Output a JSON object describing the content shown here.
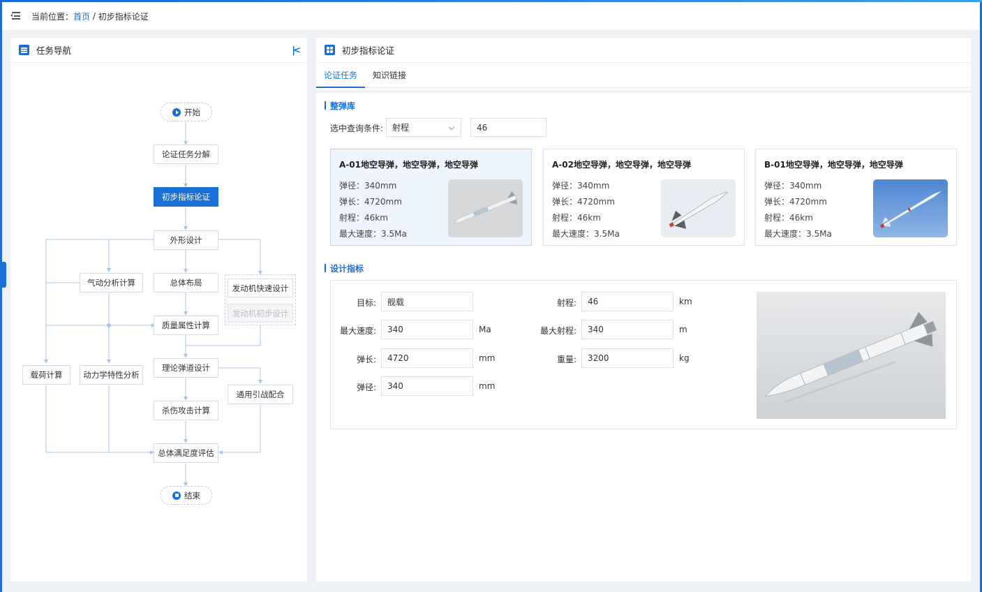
{
  "breadcrumb": {
    "prefix": "当前位置：",
    "home": "首页",
    "separator": " / ",
    "current": "初步指标论证"
  },
  "left_panel": {
    "title": "任务导航",
    "nodes": {
      "start": "开始",
      "task_decompose": "论证任务分解",
      "preliminary_index": "初步指标论证",
      "shape_design": "外形设计",
      "aero_calc": "气动分析计算",
      "overall_layout": "总体布局",
      "engine_fast": "发动机快速设计",
      "engine_prelim": "发动机初步设计",
      "mass_calc": "质量属性计算",
      "trajectory": "理论弹道设计",
      "payload_calc": "载荷计算",
      "dynamics": "动力学特性分析",
      "fuze": "通用引战配合",
      "kill_calc": "杀伤攻击计算",
      "satisfaction": "总体满足度评估",
      "end": "结束"
    }
  },
  "right_panel": {
    "title": "初步指标论证",
    "tabs": [
      {
        "label": "论证任务",
        "active": true
      },
      {
        "label": "知识链接",
        "active": false
      }
    ],
    "library": {
      "title": "整弹库",
      "query_label": "选中查询条件:",
      "query_field": "射程",
      "query_value": "46",
      "cards": [
        {
          "title": "A-01地空导弹，地空导弹，地空导弹",
          "diameter": "弹径：340mm",
          "length": "弹长：4720mm",
          "range": "射程：46km",
          "speed": "最大速度：3.5Ma",
          "selected": true
        },
        {
          "title": "A-02地空导弹，地空导弹，地空导弹",
          "diameter": "弹径：340mm",
          "length": "弹长：4720mm",
          "range": "射程：46km",
          "speed": "最大速度：3.5Ma",
          "selected": false
        },
        {
          "title": "B-01地空导弹，地空导弹，地空导弹",
          "diameter": "弹径：340mm",
          "length": "弹长：4720mm",
          "range": "射程：46km",
          "speed": "最大速度：3.5Ma",
          "selected": false
        }
      ]
    },
    "design": {
      "title": "设计指标",
      "fields": {
        "target": {
          "label": "目标:",
          "value": "舰载",
          "unit": ""
        },
        "max_speed": {
          "label": "最大速度:",
          "value": "340",
          "unit": "Ma"
        },
        "length": {
          "label": "弹长:",
          "value": "4720",
          "unit": "mm"
        },
        "diameter": {
          "label": "弹径:",
          "value": "340",
          "unit": "mm"
        },
        "range": {
          "label": "射程:",
          "value": "46",
          "unit": "km"
        },
        "max_range": {
          "label": "最大射程:",
          "value": "340",
          "unit": "m"
        },
        "weight": {
          "label": "重量:",
          "value": "3200",
          "unit": "kg"
        }
      }
    }
  },
  "colors": {
    "accent": "#1a6fd6",
    "background": "#eef1f5"
  }
}
